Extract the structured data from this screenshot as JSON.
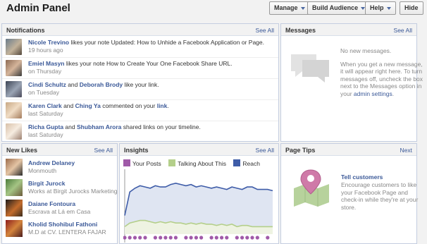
{
  "header": {
    "title": "Admin Panel",
    "manage": "Manage",
    "build_audience": "Build Audience",
    "help": "Help",
    "hide": "Hide"
  },
  "notifications": {
    "title": "Notifications",
    "see_all": "See All",
    "items": [
      {
        "actor1": "Nicole Trevino",
        "text": " likes your note Updated: How to Unhide a Facebook Application or Page.",
        "time": "19 hours ago"
      },
      {
        "actor1": "Emiel Masyn",
        "text": " likes your note How to Create Your One Facebook Share URL.",
        "time": "on Thursday"
      },
      {
        "actor1": "Cindi Schultz",
        "mid": " and ",
        "actor2": "Deborah Brody",
        "text": " like your link.",
        "time": "on Tuesday"
      },
      {
        "actor1": "Karen Clark",
        "mid": " and ",
        "actor2": "Ching Ya",
        "text": " commented on your ",
        "obj": "link",
        "tail": ".",
        "time": "last Saturday"
      },
      {
        "actor1": "Richa Gupta",
        "mid": " and ",
        "actor2": "Shubham Arora",
        "text": " shared links on your timeline.",
        "time": "last Saturday"
      }
    ]
  },
  "messages": {
    "title": "Messages",
    "see_all": "See All",
    "empty": "No new messages.",
    "info": "When you get a new message, it will appear right here. To turn messages off, uncheck the box next to the Messages option in your ",
    "settings_link": "admin settings",
    "settings_tail": "."
  },
  "new_likes": {
    "title": "New Likes",
    "see_all": "See All",
    "items": [
      {
        "name": "Andrew Delaney",
        "sub": "Monmouth"
      },
      {
        "name": "Birgit Jurock",
        "sub": "Works at Birgit Jurocks Marketing ..."
      },
      {
        "name": "Daiane Fontoura",
        "sub": "Escrava at Lá em Casa"
      },
      {
        "name": "Kholid Shohibul Fathoni",
        "sub": "M.D at CV. LENTERA FAJAR"
      }
    ]
  },
  "insights": {
    "title": "Insights",
    "see_all": "See All",
    "legend": [
      {
        "label": "Your Posts",
        "color": "#a05aa8"
      },
      {
        "label": "Talking About This",
        "color": "#b4cf8a"
      },
      {
        "label": "Reach",
        "color": "#3e5ca8"
      }
    ]
  },
  "chart_data": {
    "type": "line",
    "series": [
      {
        "name": "Reach",
        "color": "#3e5ca8",
        "values": [
          15,
          34,
          37,
          39,
          38,
          37,
          39,
          38,
          38,
          40,
          41,
          40,
          39,
          40,
          38,
          39,
          38,
          37,
          38,
          37,
          36,
          38,
          37,
          36,
          38,
          38,
          36,
          36,
          36,
          35
        ]
      },
      {
        "name": "Talking About This",
        "color": "#b4cf8a",
        "values": [
          6,
          9,
          10,
          11,
          11,
          10,
          9,
          10,
          9,
          10,
          9,
          9,
          8,
          9,
          8,
          9,
          8,
          8,
          7,
          8,
          7,
          8,
          6,
          7,
          7,
          6,
          6,
          6,
          6,
          6
        ]
      },
      {
        "name": "Your Posts",
        "color": "#a05aa8",
        "values": [
          1,
          1,
          1,
          1,
          1,
          0,
          1,
          1,
          1,
          1,
          1,
          0,
          1,
          1,
          1,
          1,
          0,
          1,
          1,
          1,
          1,
          0,
          1,
          1,
          1,
          1,
          1,
          0,
          1,
          0
        ]
      }
    ],
    "ylim": [
      0,
      50
    ],
    "grid": false,
    "legend": "top-left"
  },
  "page_tips": {
    "title": "Page Tips",
    "next": "Next",
    "tip_title": "Tell customers",
    "tip_text": "Encourage customers to like your Facebook Page and check-in while they're at your store."
  },
  "icons": {
    "caret": "chevron-down-icon",
    "messages": "chat-bubbles-icon",
    "map": "map-pin-icon",
    "avatar": "user-photo"
  }
}
